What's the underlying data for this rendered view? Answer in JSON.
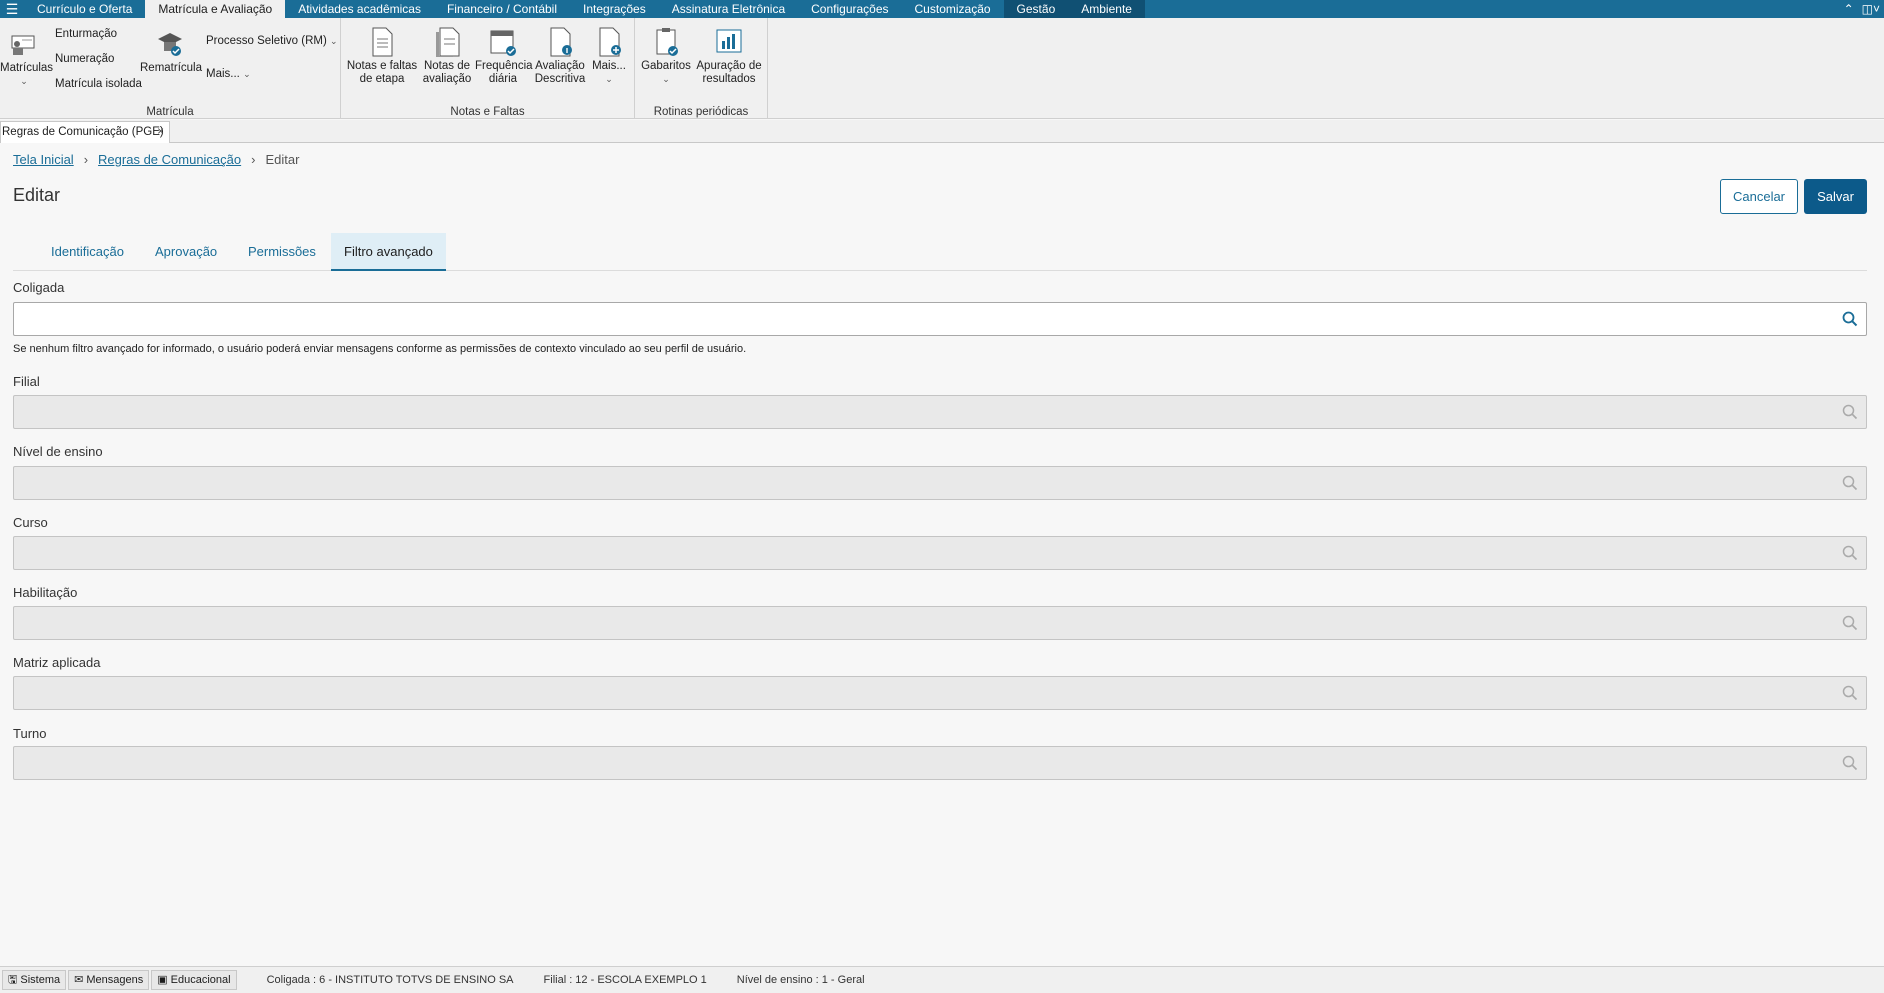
{
  "topnav": {
    "tabs": [
      "Currículo e Oferta",
      "Matrícula e Avaliação",
      "Atividades acadêmicas",
      "Financeiro / Contábil",
      "Integrações",
      "Assinatura Eletrônica",
      "Configurações",
      "Customização",
      "Gestão",
      "Ambiente"
    ],
    "active_index": 1
  },
  "ribbon": {
    "matricula": {
      "matriculas": "Matrículas",
      "enturmacao": "Enturmação",
      "numeracao": "Numeração",
      "matricula_isolada": "Matrícula isolada",
      "rematricula": "Rematrícula",
      "processo_seletivo": "Processo Seletivo (RM)",
      "mais": "Mais...",
      "label": "Matrícula"
    },
    "notas": {
      "notas_faltas_1": "Notas e faltas",
      "notas_faltas_2": "de etapa",
      "notas_aval_1": "Notas de",
      "notas_aval_2": "avaliação",
      "freq_1": "Frequência",
      "freq_2": "diária",
      "aval_1": "Avaliação",
      "aval_2": "Descritiva",
      "mais": "Mais...",
      "label": "Notas e Faltas"
    },
    "rotinas": {
      "gabaritos": "Gabaritos",
      "apur_1": "Apuração de",
      "apur_2": "resultados",
      "label": "Rotinas periódicas"
    }
  },
  "doc_tab": {
    "label": "Regras de Comunicação (PGE)"
  },
  "breadcrumb": {
    "home": "Tela Inicial",
    "parent": "Regras de Comunicação",
    "current": "Editar"
  },
  "page": {
    "title": "Editar",
    "cancel": "Cancelar",
    "save": "Salvar"
  },
  "tabs": [
    "Identificação",
    "Aprovação",
    "Permissões",
    "Filtro avançado"
  ],
  "form": {
    "coligada": {
      "label": "Coligada",
      "value": ""
    },
    "hint": "Se nenhum filtro avançado for informado, o usuário poderá enviar mensagens conforme as permissões de contexto vinculado ao seu perfil de usuário.",
    "filial": {
      "label": "Filial",
      "value": ""
    },
    "nivel": {
      "label": "Nível de ensino",
      "value": ""
    },
    "curso": {
      "label": "Curso",
      "value": ""
    },
    "habilitacao": {
      "label": "Habilitação",
      "value": ""
    },
    "matriz": {
      "label": "Matriz aplicada",
      "value": ""
    },
    "turno": {
      "label": "Turno",
      "value": ""
    }
  },
  "statusbar": {
    "sistema": "Sistema",
    "mensagens": "Mensagens",
    "educacional": "Educacional",
    "coligada": "Coligada : 6 - INSTITUTO TOTVS DE ENSINO SA",
    "filial": "Filial : 12 - ESCOLA EXEMPLO 1",
    "nivel": "Nível de ensino : 1 - Geral"
  },
  "colors": {
    "brand": "#1a6d97",
    "save": "#0c5a8a"
  }
}
